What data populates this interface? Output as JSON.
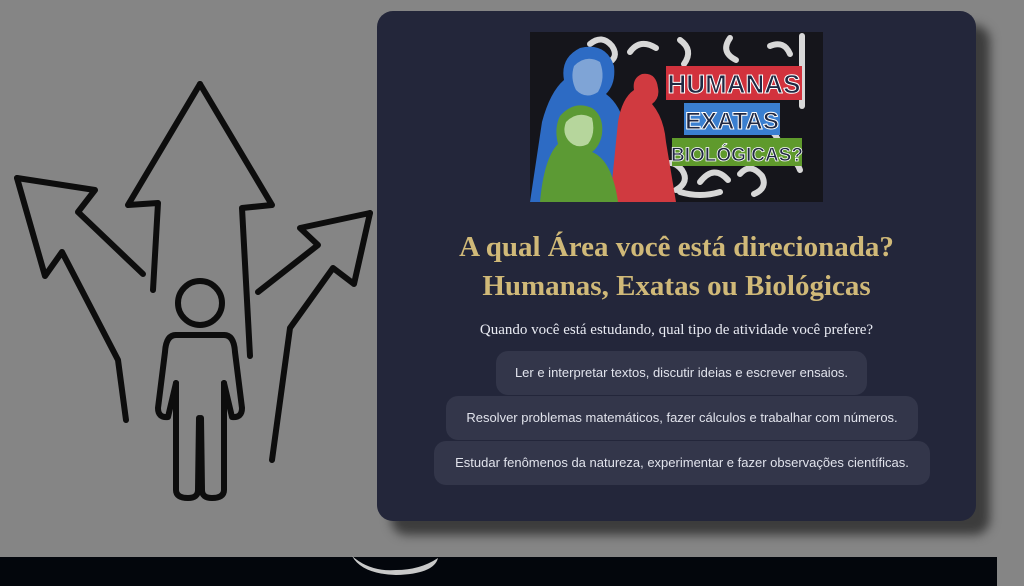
{
  "quiz": {
    "banner": {
      "line1": "HUMANAS",
      "line2": "EXATAS",
      "line3": "BIOLÓGICAS?"
    },
    "title_line1": "A qual Área você está direcionada?",
    "title_line2": "Humanas, Exatas ou Biológicas",
    "question": "Quando você está estudando, qual tipo de atividade você prefere?",
    "options": [
      {
        "label": "Ler e interpretar textos, discutir ideias e escrever ensaios."
      },
      {
        "label": "Resolver problemas matemáticos, fazer cálculos e trabalhar com números."
      },
      {
        "label": "Estudar fenômenos da natureza, experimentar e fazer observações científicas."
      }
    ]
  },
  "colors": {
    "page_background": "#858585",
    "card_background": "#23263a",
    "title": "#d0b978",
    "option_background": "#33364a",
    "bottom_bar": "#03060c"
  },
  "illustration_icon": "person-crossroads-arrows-icon"
}
